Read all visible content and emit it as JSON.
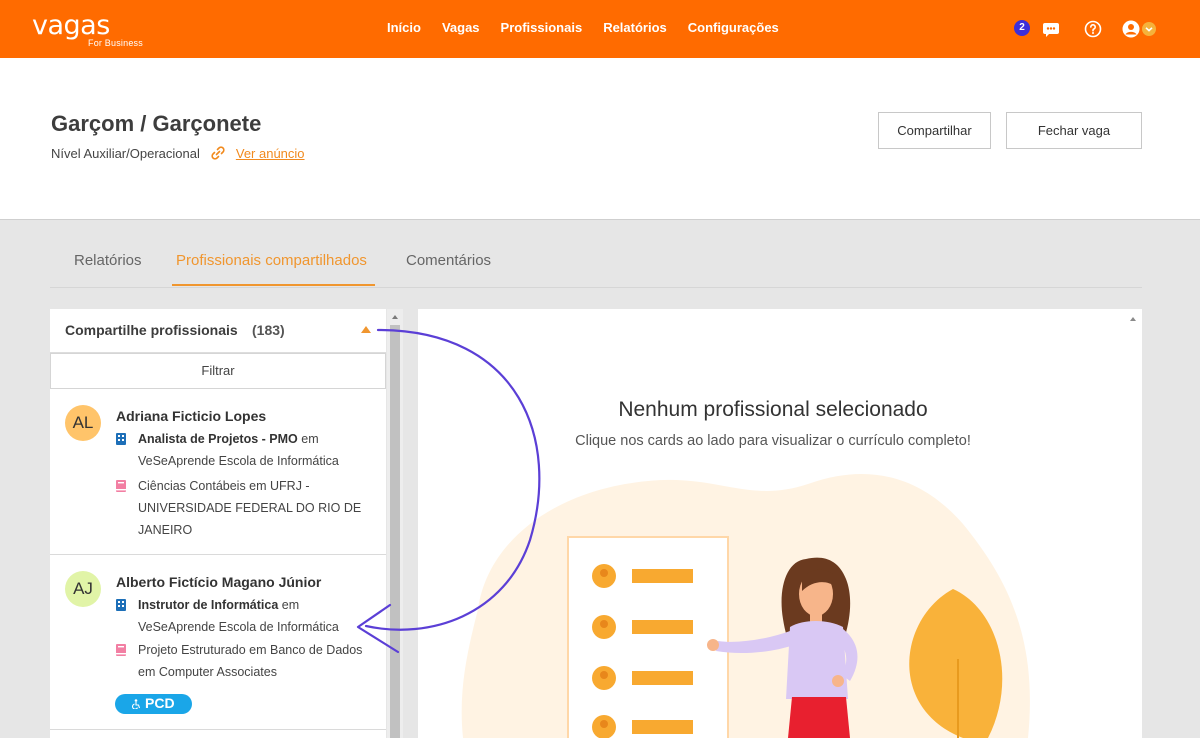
{
  "brand": {
    "name": "vagas",
    "sub": "For Business"
  },
  "nav": {
    "items": [
      "Início",
      "Vagas",
      "Profissionais",
      "Relatórios",
      "Configurações"
    ]
  },
  "notifications": {
    "count": "2"
  },
  "job": {
    "title": "Garçom / Garçonete",
    "level": "Nível Auxiliar/Operacional",
    "view_link": "Ver anúncio",
    "share_button": "Compartilhar",
    "close_button": "Fechar vaga"
  },
  "tabs": {
    "reports": "Relatórios",
    "shared": "Profissionais compartilhados",
    "comments": "Comentários"
  },
  "list": {
    "title": "Compartilhe profissionais",
    "count": "(183)",
    "filter": "Filtrar",
    "cards": [
      {
        "initials": "AL",
        "name": "Adriana Ficticio Lopes",
        "job_role": "Analista de Projetos - PMO",
        "job_rest": " em VeSeAprende Escola de Informática",
        "education": "Ciências Contábeis em UFRJ - UNIVERSIDADE FEDERAL DO RIO DE JANEIRO"
      },
      {
        "initials": "AJ",
        "name": "Alberto Fictício Magano Júnior",
        "job_role": "Instrutor de Informática",
        "job_rest": " em VeSeAprende Escola de Informática",
        "education": "Projeto Estruturado em Banco de Dados em Computer Associates",
        "badge": "PCD"
      }
    ]
  },
  "detail": {
    "title": "Nenhum profissional selecionado",
    "subtitle": "Clique nos cards ao lado para visualizar o currículo completo!"
  },
  "colors": {
    "brand_orange": "#ff6b00",
    "accent_orange": "#f0962f",
    "badge_blue": "#3d2fd9",
    "pcd_blue": "#1aa6e8",
    "arrow_purple": "#5b3fd6"
  }
}
